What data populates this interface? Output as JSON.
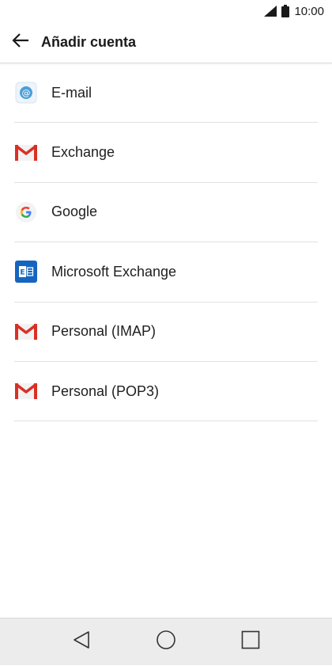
{
  "status_bar": {
    "time": "10:00",
    "signal_icon": "signal-icon",
    "battery_icon": "battery-icon"
  },
  "app_bar": {
    "back_icon": "arrow-left-icon",
    "title": "Añadir cuenta"
  },
  "accounts": [
    {
      "label": "E-mail",
      "icon": "email-at-icon"
    },
    {
      "label": "Exchange",
      "icon": "gmail-icon"
    },
    {
      "label": "Google",
      "icon": "google-icon"
    },
    {
      "label": "Microsoft Exchange",
      "icon": "microsoft-exchange-icon"
    },
    {
      "label": "Personal (IMAP)",
      "icon": "gmail-icon"
    },
    {
      "label": "Personal (POP3)",
      "icon": "gmail-icon"
    }
  ],
  "nav_bar": {
    "back_icon": "nav-back-triangle-icon",
    "home_icon": "nav-home-circle-icon",
    "recents_icon": "nav-recents-square-icon"
  },
  "colors": {
    "gmail_red": "#d93025",
    "google_blue": "#4285f4",
    "google_red": "#ea4335",
    "google_yellow": "#fbbc05",
    "google_green": "#34a853",
    "exchange_blue": "#1565c0",
    "email_blue": "#4a9fd8"
  }
}
